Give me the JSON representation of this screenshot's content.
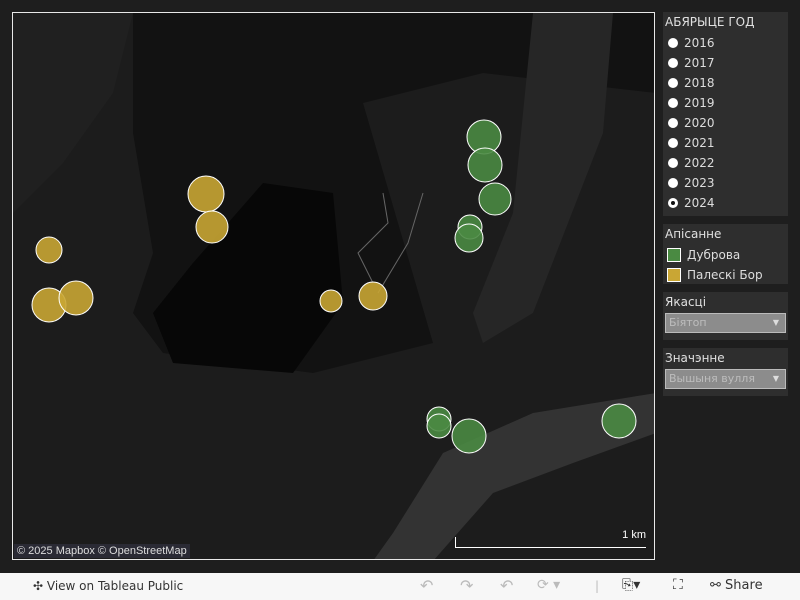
{
  "map": {
    "attribution": "© 2025 Mapbox  © OpenStreetMap",
    "scale": "1 km",
    "colors": {
      "Дуброва": "#4a8a42",
      "Палескі Бор": "#c9a634"
    }
  },
  "year_filter": {
    "title": "АБЯРЫЦЕ ГОД",
    "options": [
      "2016",
      "2017",
      "2018",
      "2019",
      "2020",
      "2021",
      "2022",
      "2023",
      "2024"
    ],
    "selected": "2024"
  },
  "legend": {
    "title": "Апісанне",
    "items": [
      {
        "label": "Дуброва",
        "color": "#4a8a42"
      },
      {
        "label": "Палескі Бор",
        "color": "#c9a634"
      }
    ]
  },
  "quality": {
    "title": "Якасці",
    "value": "Біятоп"
  },
  "meaning": {
    "title": "Значэнне",
    "value": "Вышыня вулля"
  },
  "toolbar": {
    "view": "View on Tableau Public",
    "share": "Share"
  }
}
